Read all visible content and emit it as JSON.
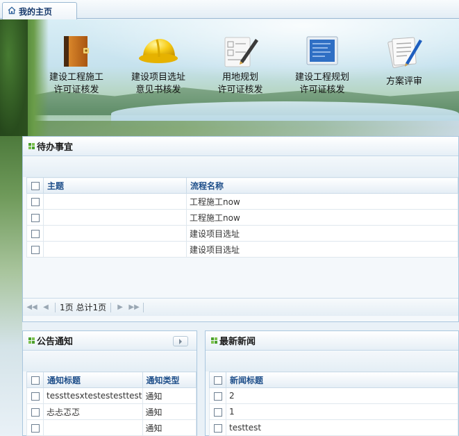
{
  "tab": {
    "label": "我的主页",
    "icon": "home-icon"
  },
  "quick_links": [
    {
      "line1": "建设工程施工",
      "line2": "许可证核发",
      "icon": "book-icon"
    },
    {
      "line1": "建设项目选址",
      "line2": "意见书核发",
      "icon": "hardhat-icon"
    },
    {
      "line1": "用地规划",
      "line2": "许可证核发",
      "icon": "document-pen-icon"
    },
    {
      "line1": "建设工程规划",
      "line2": "许可证核发",
      "icon": "blueprint-icon"
    },
    {
      "line1": "方案评审",
      "line2": "",
      "icon": "papers-pen-icon"
    }
  ],
  "todo": {
    "title": "待办事宜",
    "columns": [
      "主题",
      "流程名称"
    ],
    "rows": [
      {
        "subject": "",
        "process": "工程施工now"
      },
      {
        "subject": "",
        "process": "工程施工now"
      },
      {
        "subject": "",
        "process": "建设项目选址"
      },
      {
        "subject": "",
        "process": "建设项目选址"
      }
    ],
    "pager": {
      "text": "1页 总计1页"
    }
  },
  "notice": {
    "title": "公告通知",
    "columns": [
      "通知标题",
      "通知类型"
    ],
    "rows": [
      {
        "title": "tessttesxtestestesttest",
        "type": "通知"
      },
      {
        "title": "忐忐忑忑",
        "type": "通知"
      },
      {
        "title": "",
        "type": "通知"
      }
    ]
  },
  "news": {
    "title": "最新新闻",
    "columns": [
      "新闻标题"
    ],
    "rows": [
      {
        "title": "2"
      },
      {
        "title": "1"
      },
      {
        "title": "testtest"
      }
    ]
  }
}
